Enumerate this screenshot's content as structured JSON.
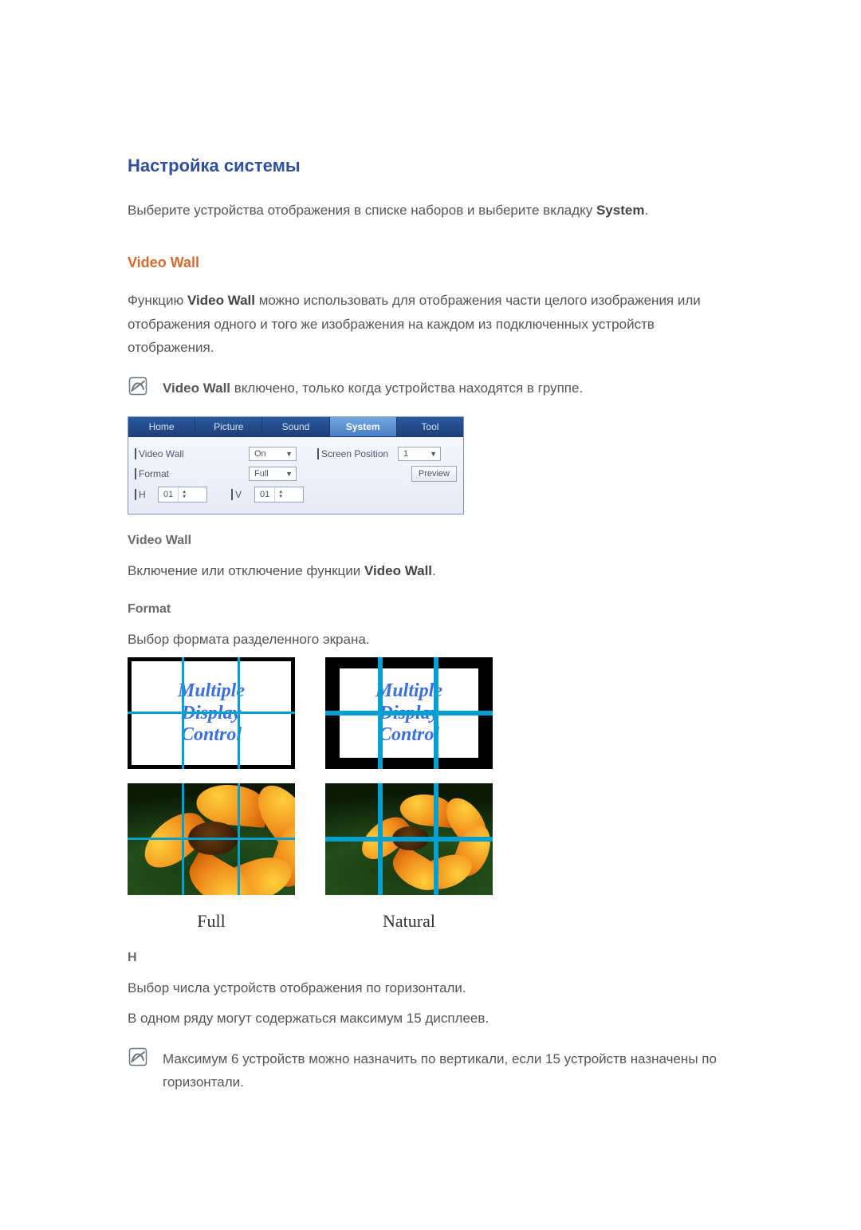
{
  "headings": {
    "system_setup": "Настройка системы",
    "video_wall": "Video Wall",
    "video_wall_sub": "Video Wall",
    "format_sub": "Format",
    "h_sub": "H"
  },
  "paragraphs": {
    "select_devices_prefix": "Выберите устройства отображения в списке наборов и выберите вкладку ",
    "system_bold": "System",
    "vw_usage_prefix": "Функцию ",
    "vw_bold": "Video Wall",
    "vw_usage_suffix": " можно использовать для отображения части целого изображения или отображения одного и того же изображения на каждом из подключенных устройств отображения.",
    "vw_on_group_prefix_bold": "Video Wall",
    "vw_on_group_suffix": " включено, только когда устройства находятся в группе.",
    "vw_enable_prefix": "Включение или отключение функции ",
    "vw_enable_bold": "Video Wall",
    "format_choose": "Выбор формата разделенного экрана.",
    "h_desc": "Выбор числа устройств отображения по горизонтали.",
    "h_max_row": "В одном ряду могут содержаться максимум 15 дисплеев.",
    "h_note": "Максимум 6 устройств можно назначить по вертикали, если 15 устройств назначены по горизонтали."
  },
  "tabs": [
    "Home",
    "Picture",
    "Sound",
    "System",
    "Tool"
  ],
  "panel": {
    "video_wall_label": "Video Wall",
    "video_wall_value": "On",
    "screen_position_label": "Screen Position",
    "screen_position_value": "1",
    "format_label": "Format",
    "format_value": "Full",
    "preview": "Preview",
    "h_label": "H",
    "h_value": "01",
    "v_label": "V",
    "v_value": "01"
  },
  "illustration": {
    "mdc_line1": "Multiple",
    "mdc_line2": "Display",
    "mdc_line3": "Control",
    "full_caption": "Full",
    "natural_caption": "Natural"
  }
}
